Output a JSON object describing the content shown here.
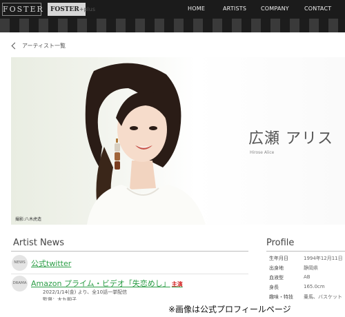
{
  "header": {
    "logo_main": "FOSTER",
    "logo_plus_word": "FOSTER",
    "logo_plus_suffix": "+plus",
    "nav": [
      "HOME",
      "ARTISTS",
      "COMPANY",
      "CONTACT"
    ]
  },
  "breadcrumb": {
    "back_label": "アーティスト一覧",
    "icon": "chevron-left-icon"
  },
  "hero": {
    "name_ja": "広瀬 アリス",
    "name_en": "Hirose Alice",
    "photo_credit": "撮影:八木虎造"
  },
  "news": {
    "heading": "Artist News",
    "items": [
      {
        "badge": "NEWS",
        "title": "公式twitter",
        "tag": "",
        "lines": []
      },
      {
        "badge": "DRAMA",
        "title": "Amazon プライム・ビデオ「失恋めし」",
        "tag": "主演",
        "lines": [
          "2022/1/14(金) より、全10話一挙配信",
          "監督：大九明子"
        ]
      }
    ]
  },
  "profile": {
    "heading": "Profile",
    "rows": [
      {
        "key": "生年月日",
        "value": "1994年12月11日"
      },
      {
        "key": "出身地",
        "value": "静岡県"
      },
      {
        "key": "血液型",
        "value": "AB"
      },
      {
        "key": "身長",
        "value": "165.0cm"
      },
      {
        "key": "趣味・特技",
        "value": "乗馬、バスケット"
      }
    ]
  },
  "caption": "※画像は公式プロフィールページ",
  "colors": {
    "accent_green": "#2a9d45",
    "tag_red": "#d11a1a",
    "header_bg": "#1b1b1b"
  }
}
